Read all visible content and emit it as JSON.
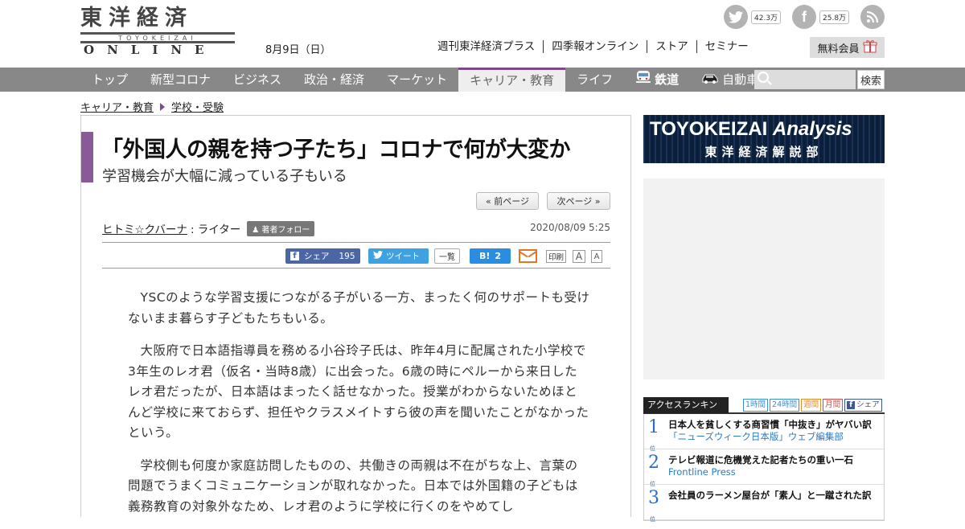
{
  "header": {
    "logo_top": "東洋経済",
    "logo_sub": "TOYOKEIZAI",
    "logo_bottom": "ONLINE",
    "date": "8月9日（日）",
    "social": {
      "twitter_count": "42.3万",
      "facebook_count": "25.8万"
    },
    "top_links": [
      "週刊東洋経済プラス",
      "四季報オンライン",
      "ストア",
      "セミナー"
    ],
    "member_button": "無料会員"
  },
  "nav": {
    "items": [
      "トップ",
      "新型コロナ",
      "ビジネス",
      "政治・経済",
      "マーケット",
      "キャリア・教育",
      "ライフ",
      "鉄道",
      "自動車"
    ],
    "active_index": 5,
    "search_placeholder": "",
    "search_button": "検索"
  },
  "breadcrumb": [
    "キャリア・教育",
    "学校・受験"
  ],
  "article": {
    "title": "「外国人の親を持つ子たち」コロナで何が大変か",
    "subtitle": "学習機会が大幅に減っている子もいる",
    "prev_page": "« 前ページ",
    "next_page": "次ページ »",
    "author": "ヒトミ☆クバーナ",
    "author_role": ": ライター",
    "follow_label": "著者フォロー",
    "published": "2020/08/09 5:25",
    "share": {
      "fb_label": "シェア",
      "fb_count": "195",
      "tweet_label": "ツイート",
      "list_label": "一覧",
      "hatena_label": "B!",
      "hatena_count": "2",
      "print_label": "印刷",
      "font_large": "A",
      "font_small": "A"
    },
    "paragraphs": [
      "YSCのような学習支援につながる子がいる一方、まったく何のサポートも受けないまま暮らす子どもたちもいる。",
      "大阪府で日本語指導員を務める小谷玲子氏は、昨年4月に配属された小学校で3年生のレオ君（仮名・当時8歳）に出会った。6歳の時にペルーから来日したレオ君だったが、日本語はまったく話せなかった。授業がわからないためほとんど学校に来ておらず、担任やクラスメイトすら彼の声を聞いたことがなかったという。",
      "学校側も何度か家庭訪問したものの、共働きの両親は不在がちな上、言葉の問題でうまくコミュニケーションが取れなかった。日本では外国籍の子どもは義務教育の対象外なため、レオ君のように学校に行くのをやめてし"
    ]
  },
  "sidebar": {
    "banner_title_a": "TOYOKEIZAI",
    "banner_title_b": "Analysis",
    "banner_sub": "東洋経済解説部",
    "ranking": {
      "title": "アクセスランキング",
      "tabs": [
        "1時間",
        "24時間",
        "週間",
        "月間",
        "シェア"
      ],
      "rank_suffix": "位",
      "items": [
        {
          "rank": "1",
          "headline": "日本人を貧しくする商習慣「中抜き」がヤバい訳",
          "source": "「ニューズウィーク日本版」ウェブ編集部"
        },
        {
          "rank": "2",
          "headline": "テレビ報道に危機覚えた記者たちの重い一石",
          "source": "Frontline Press"
        },
        {
          "rank": "3",
          "headline": "会社員のラーメン屋台が「素人」と一蹴された訳",
          "source": ""
        }
      ]
    }
  },
  "colors": {
    "accent_purple": "#8a5a98",
    "nav_gray": "#888888",
    "facebook_blue": "#4a66a5",
    "twitter_blue": "#3da1e2",
    "hatena_blue": "#2a8de0",
    "rank_blue": "#2a6dc4"
  }
}
